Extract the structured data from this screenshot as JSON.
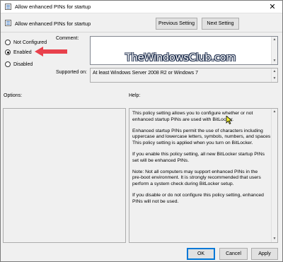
{
  "window": {
    "title": "Allow enhanced PINs for startup",
    "close_glyph": "✕"
  },
  "header": {
    "policy_name": "Allow enhanced PINs for startup",
    "previous_label": "Previous Setting",
    "next_label": "Next Setting"
  },
  "state": {
    "options": [
      {
        "label": "Not Configured",
        "checked": false
      },
      {
        "label": "Enabled",
        "checked": true
      },
      {
        "label": "Disabled",
        "checked": false
      }
    ]
  },
  "comment": {
    "label": "Comment:",
    "value": ""
  },
  "supported": {
    "label": "Supported on:",
    "value": "At least Windows Server 2008 R2 or Windows 7"
  },
  "watermark": "TheWindowsClub.com",
  "options_section": {
    "label": "Options:"
  },
  "help_section": {
    "label": "Help:",
    "paragraphs": [
      "This policy setting allows you to configure whether or not\nenhanced startup PINs are used with BitLocker.",
      "Enhanced startup PINs permit the use of characters including\nuppercase and lowercase letters, symbols, numbers, and spaces.\nThis policy setting is applied when you turn on BitLocker.",
      "If you enable this policy setting, all new BitLocker startup PINs\nset will be enhanced PINs.",
      "Note:   Not all computers may support enhanced PINs in the\npre-boot environment. It is strongly recommended that users\nperform a system check during BitLocker setup.",
      "If you disable or do not configure this policy setting, enhanced\nPINs will not be used."
    ]
  },
  "footer": {
    "ok_label": "OK",
    "cancel_label": "Cancel",
    "apply_label": "Apply"
  },
  "colors": {
    "accent": "#0078d7",
    "arrow": "#e8414c"
  },
  "icons": [
    "policy-icon",
    "close-icon",
    "scroll-up-icon",
    "scroll-down-icon",
    "arrow-annotation-icon",
    "mouse-cursor-icon"
  ]
}
